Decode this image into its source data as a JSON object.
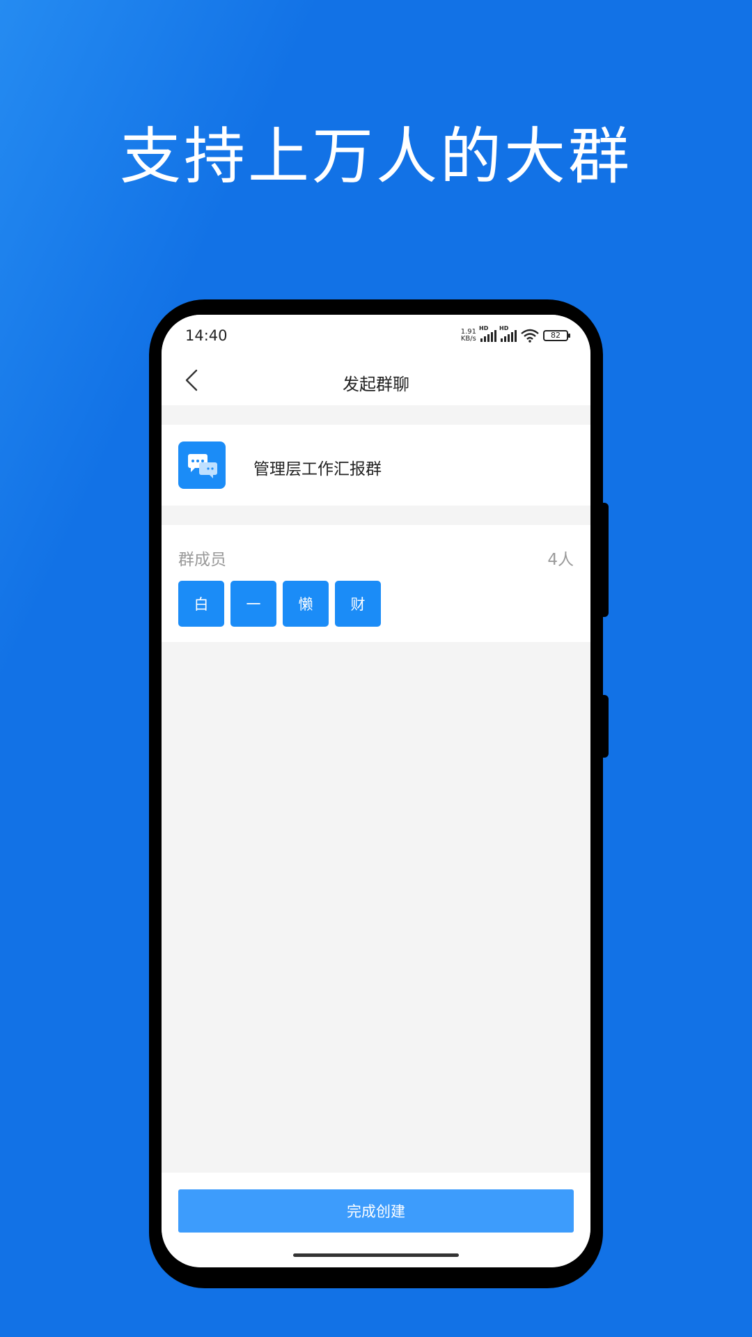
{
  "headline": "支持上万人的大群",
  "colors": {
    "background": "#1272e6",
    "accent": "#1b8cf7",
    "primary_button": "#3d9cfc"
  },
  "status_bar": {
    "time": "14:40",
    "net_speed_value": "1.91",
    "net_speed_unit": "KB/s",
    "signal_label": "HD",
    "battery": "82"
  },
  "nav": {
    "back_icon": "chevron-left-icon",
    "title": "发起群聊"
  },
  "group": {
    "icon": "chat-bubbles-icon",
    "name": "管理层工作汇报群"
  },
  "members": {
    "label": "群成员",
    "count": "4人",
    "chips": [
      "白",
      "一",
      "懒",
      "财"
    ]
  },
  "footer": {
    "finish_label": "完成创建"
  }
}
